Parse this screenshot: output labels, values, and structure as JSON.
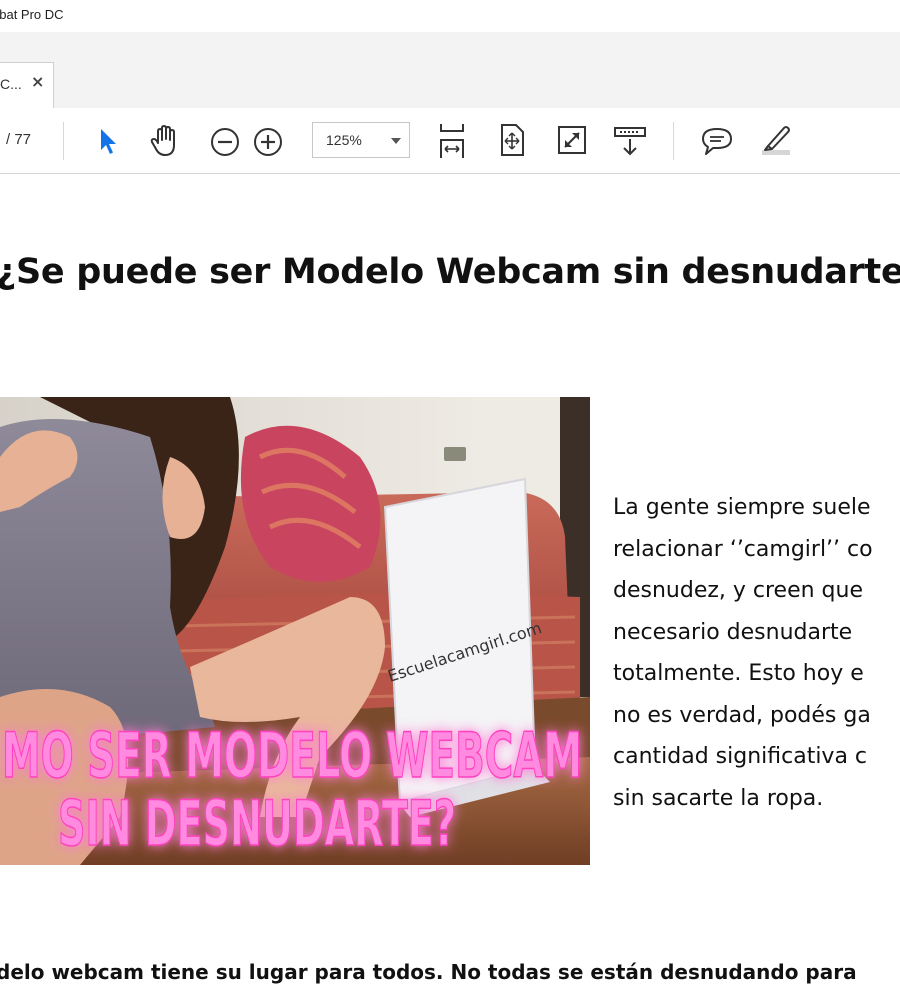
{
  "app": {
    "title": "obat Pro DC"
  },
  "tabs": [
    {
      "label": "C...",
      "close_icon": "close-icon"
    }
  ],
  "toolbar": {
    "page_count": "/ 77",
    "zoom_value": "125%",
    "icons": [
      "select-arrow-icon",
      "hand-tool-icon",
      "zoom-out-icon",
      "zoom-in-icon",
      "fit-width-icon",
      "fit-page-icon",
      "fullscreen-icon",
      "scrolling-mode-icon",
      "comment-icon",
      "highlight-pen-icon"
    ],
    "accent_color": "#1473e6"
  },
  "document": {
    "title": "¿Se puede ser Modelo Webcam sin desnudarte",
    "image": {
      "watermark": "Escuelacamgirl.com",
      "caption_line1": "MO SER MODELO WEBCAM",
      "caption_line2": "SIN DESNUDARTE?",
      "caption_color": "#ff7ad9"
    },
    "paragraph_lines": [
      "La gente siempre suele",
      "relacionar ‘’camgirl’’ co",
      "desnudez, y creen que",
      "necesario desnudarte",
      "totalmente. Esto hoy e",
      "no es verdad, podés ga",
      "cantidad significativa c",
      "sin sacarte la ropa."
    ],
    "bottom_text": "delo webcam tiene su lugar para todos. No todas se están desnudando para"
  }
}
